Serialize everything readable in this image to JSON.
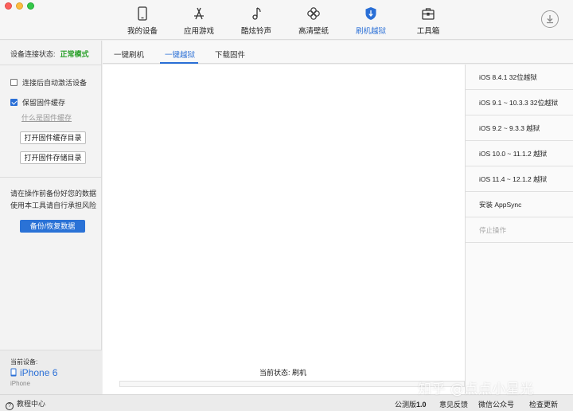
{
  "toolbar": {
    "nav": [
      {
        "label": "我的设备",
        "icon": "phone-icon"
      },
      {
        "label": "应用游戏",
        "icon": "app-store-icon"
      },
      {
        "label": "酷炫铃声",
        "icon": "music-note-icon"
      },
      {
        "label": "高清壁纸",
        "icon": "flower-icon"
      },
      {
        "label": "刷机越狱",
        "icon": "shield-icon"
      },
      {
        "label": "工具箱",
        "icon": "toolbox-icon"
      }
    ],
    "active_index": 4,
    "download_icon": "download-icon"
  },
  "sidebar": {
    "status_label": "设备连接状态:",
    "status_value": "正常模式",
    "options": [
      {
        "label": "连接后自动激活设备",
        "checked": false
      },
      {
        "label": "保留固件缓存",
        "checked": true
      }
    ],
    "what_is_cache": "什么是固件缓存",
    "open_cache_dir": "打开固件缓存目录",
    "open_storage_dir": "打开固件存储目录",
    "warning_line1": "请在操作前备份好您的数据",
    "warning_line2": "使用本工具请自行承担风险",
    "backup_button": "备份/恢复数据",
    "device_label": "当前设备:",
    "device_name": "iPhone 6",
    "device_model": "iPhone"
  },
  "tabs": [
    "一键刷机",
    "一键越狱",
    "下载固件"
  ],
  "active_tab": 1,
  "main": {
    "status_label": "当前状态: 刷机",
    "progress": 0
  },
  "right_panel": [
    {
      "label": "iOS 8.4.1 32位越狱",
      "enabled": true
    },
    {
      "label": "iOS 9.1 ~ 10.3.3 32位越狱",
      "enabled": true
    },
    {
      "label": "iOS 9.2 ~ 9.3.3 越狱",
      "enabled": true
    },
    {
      "label": "iOS 10.0 ~ 11.1.2 越狱",
      "enabled": true
    },
    {
      "label": "iOS 11.4 ~ 12.1.2 越狱",
      "enabled": true
    },
    {
      "label": "安装 AppSync",
      "enabled": true
    },
    {
      "label": "停止操作",
      "enabled": false
    }
  ],
  "footer": {
    "help": "教程中心",
    "version_label": "公测版",
    "version_number": "1.0",
    "feedback": "意见反馈",
    "wechat": "微信公众号",
    "update": "检查更新"
  },
  "watermark": "知乎 @点点小星光",
  "colors": {
    "accent": "#2a6fd6",
    "ok": "#2aa02a",
    "button_primary": "#2a72d6"
  }
}
